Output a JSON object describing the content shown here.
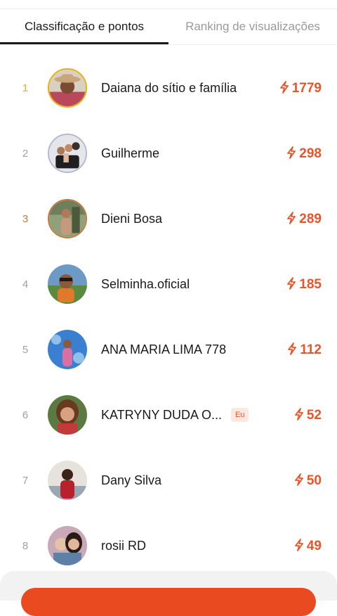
{
  "tabs": [
    {
      "label": "Classificação e pontos",
      "active": true
    },
    {
      "label": "Ranking de visualizações",
      "active": false
    }
  ],
  "colors": {
    "accent": "#e8552b",
    "gold": "#e8b00c",
    "silver": "#b6b6d2",
    "bronze": "#c17a43"
  },
  "ranking": [
    {
      "rank": "1",
      "name": "Daiana do sítio e família",
      "score": "1779"
    },
    {
      "rank": "2",
      "name": "Guilherme",
      "score": "298"
    },
    {
      "rank": "3",
      "name": "Dieni Bosa",
      "score": "289"
    },
    {
      "rank": "4",
      "name": "Selminha.oficial",
      "score": "185"
    },
    {
      "rank": "5",
      "name": "ANA MARIA LIMA 778",
      "score": "112"
    },
    {
      "rank": "6",
      "name": "KATRYNY DUDA O...",
      "score": "52",
      "badge": "Eu"
    },
    {
      "rank": "7",
      "name": "Dany Silva",
      "score": "50"
    },
    {
      "rank": "8",
      "name": "rosii RD",
      "score": "49"
    }
  ],
  "icons": {
    "score": "lightning-bolt-icon"
  }
}
